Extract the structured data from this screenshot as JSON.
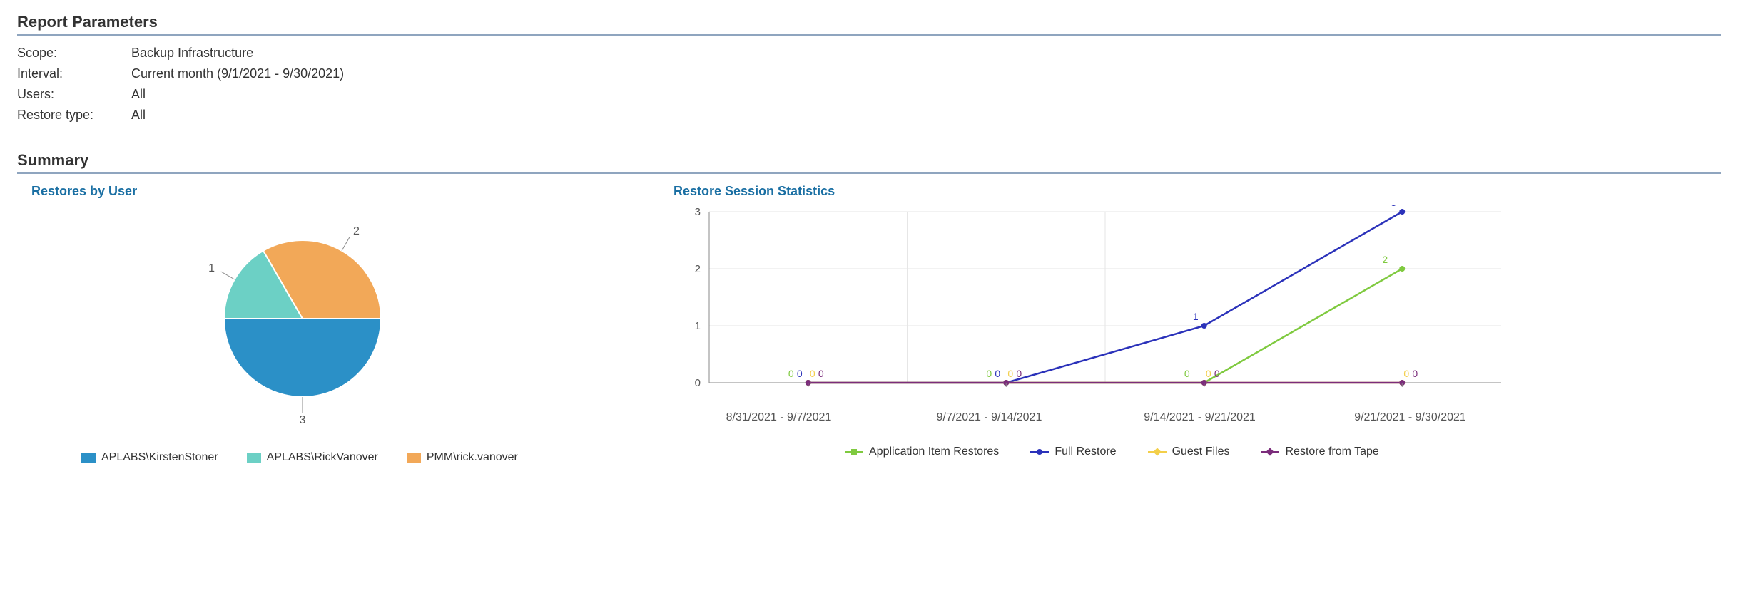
{
  "sections": {
    "parameters_title": "Report Parameters",
    "summary_title": "Summary"
  },
  "parameters": {
    "rows": [
      {
        "label": "Scope:",
        "value": "Backup Infrastructure"
      },
      {
        "label": "Interval:",
        "value": "Current month (9/1/2021 - 9/30/2021)"
      },
      {
        "label": "Users:",
        "value": "All"
      },
      {
        "label": "Restore type:",
        "value": "All"
      }
    ]
  },
  "pie": {
    "title": "Restores by User",
    "legend": [
      {
        "label": "APLABS\\KirstenStoner",
        "color": "#2b90c7"
      },
      {
        "label": "APLABS\\RickVanover",
        "color": "#6cd0c5"
      },
      {
        "label": "PMM\\rick.vanover",
        "color": "#f2a858"
      }
    ]
  },
  "line": {
    "title": "Restore Session Statistics",
    "ylabel": "",
    "legend": [
      {
        "label": "Application Item Restores",
        "color": "#7fca3f",
        "marker": "square"
      },
      {
        "label": "Full Restore",
        "color": "#2b32ba",
        "marker": "dot"
      },
      {
        "label": "Guest Files",
        "color": "#f3cf4a",
        "marker": "diamond"
      },
      {
        "label": "Restore from Tape",
        "color": "#7b2c7b",
        "marker": "x"
      }
    ]
  },
  "chart_data": [
    {
      "type": "pie",
      "title": "Restores by User",
      "series": [
        {
          "name": "APLABS\\KirstenStoner",
          "value": 3,
          "color": "#2b90c7"
        },
        {
          "name": "APLABS\\RickVanover",
          "value": 1,
          "color": "#6cd0c5"
        },
        {
          "name": "PMM\\rick.vanover",
          "value": 2,
          "color": "#f2a858"
        }
      ]
    },
    {
      "type": "line",
      "title": "Restore Session Statistics",
      "categories": [
        "8/31/2021 - 9/7/2021",
        "9/7/2021 - 9/14/2021",
        "9/14/2021 - 9/21/2021",
        "9/21/2021 - 9/30/2021"
      ],
      "ylim": [
        0,
        3
      ],
      "yticks": [
        0,
        1,
        2,
        3
      ],
      "series": [
        {
          "name": "Application Item Restores",
          "color": "#7fca3f",
          "values": [
            0,
            0,
            0,
            2
          ]
        },
        {
          "name": "Full Restore",
          "color": "#2b32ba",
          "values": [
            0,
            0,
            1,
            3
          ]
        },
        {
          "name": "Guest Files",
          "color": "#f3cf4a",
          "values": [
            0,
            0,
            0,
            0
          ]
        },
        {
          "name": "Restore from Tape",
          "color": "#7b2c7b",
          "values": [
            0,
            0,
            0,
            0
          ]
        }
      ]
    }
  ]
}
